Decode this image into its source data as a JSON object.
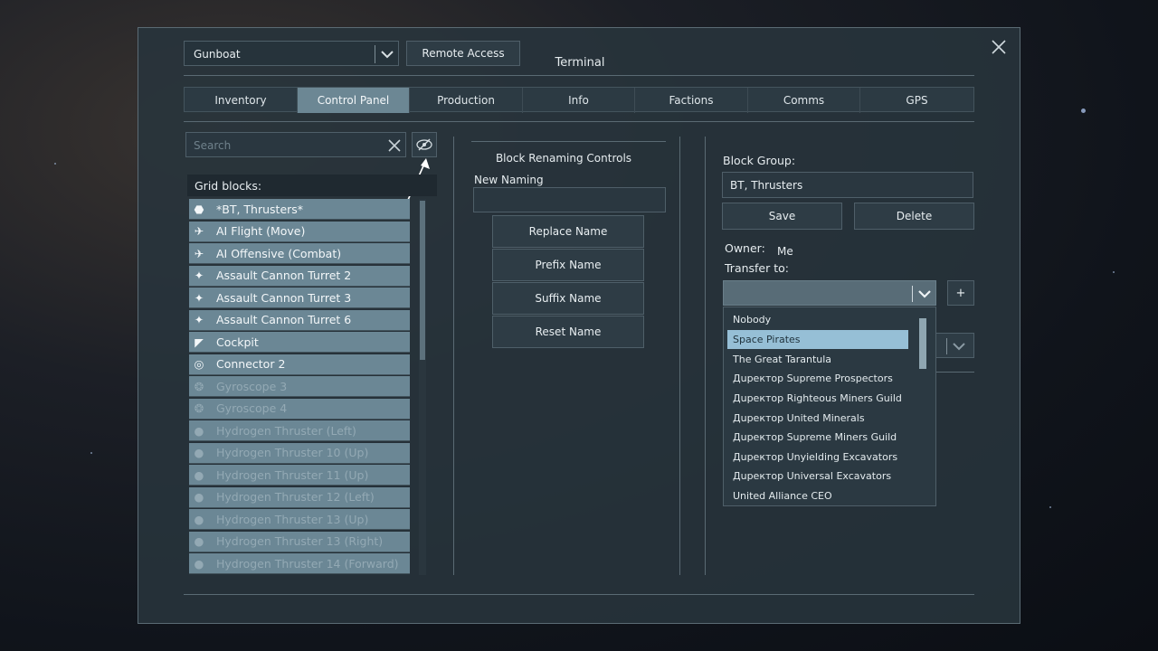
{
  "header": {
    "grid_select": "Gunboat",
    "remote_access_label": "Remote Access",
    "title": "Terminal"
  },
  "tabs": [
    {
      "label": "Inventory"
    },
    {
      "label": "Control Panel"
    },
    {
      "label": "Production"
    },
    {
      "label": "Info"
    },
    {
      "label": "Factions"
    },
    {
      "label": "Comms"
    },
    {
      "label": "GPS"
    }
  ],
  "left": {
    "search_placeholder": "Search",
    "grid_blocks_label": "Grid blocks:",
    "items": [
      {
        "label": "*BT, Thrusters*",
        "icon": "group-icon"
      },
      {
        "label": "AI Flight (Move)",
        "icon": "ai-flight-icon"
      },
      {
        "label": "AI Offensive (Combat)",
        "icon": "ai-offensive-icon"
      },
      {
        "label": "Assault Cannon Turret 2",
        "icon": "turret-icon"
      },
      {
        "label": "Assault Cannon Turret 3",
        "icon": "turret-icon"
      },
      {
        "label": "Assault Cannon Turret 6",
        "icon": "turret-icon"
      },
      {
        "label": "Cockpit",
        "icon": "cockpit-icon"
      },
      {
        "label": "Connector 2",
        "icon": "connector-icon"
      },
      {
        "label": "Gyroscope 3",
        "icon": "gyroscope-icon"
      },
      {
        "label": "Gyroscope 4",
        "icon": "gyroscope-icon"
      },
      {
        "label": "Hydrogen Thruster (Left)",
        "icon": "thruster-icon"
      },
      {
        "label": "Hydrogen Thruster 10 (Up)",
        "icon": "thruster-icon"
      },
      {
        "label": "Hydrogen Thruster 11 (Up)",
        "icon": "thruster-icon"
      },
      {
        "label": "Hydrogen Thruster 12 (Left)",
        "icon": "thruster-icon"
      },
      {
        "label": "Hydrogen Thruster 13 (Up)",
        "icon": "thruster-icon"
      },
      {
        "label": "Hydrogen Thruster 13 (Right)",
        "icon": "thruster-icon"
      },
      {
        "label": "Hydrogen Thruster 14 (Forward)",
        "icon": "thruster-icon"
      }
    ]
  },
  "middle": {
    "title": "Block Renaming Controls",
    "new_naming_label": "New Naming",
    "new_naming_value": "",
    "replace_label": "Replace Name",
    "prefix_label": "Prefix Name",
    "suffix_label": "Suffix Name",
    "reset_label": "Reset Name"
  },
  "right": {
    "block_group_label": "Block Group:",
    "block_group_value": "BT, Thrusters",
    "save_label": "Save",
    "delete_label": "Delete",
    "owner_label": "Owner:",
    "owner_value": "Me",
    "transfer_label": "Transfer to:",
    "transfer_value": "",
    "add_label": "+",
    "owners": [
      {
        "label": "Nobody"
      },
      {
        "label": "Space Pirates"
      },
      {
        "label": "The Great Tarantula"
      },
      {
        "label": "Дupeктop Supreme Prospectors"
      },
      {
        "label": "Дupeктop Righteous Miners Guild"
      },
      {
        "label": "Дupeктop United Minerals"
      },
      {
        "label": "Дupeктop Supreme Miners Guild"
      },
      {
        "label": "Дupeктop Unyielding Excavators"
      },
      {
        "label": "Дupeктop Universal Excavators"
      },
      {
        "label": "United Alliance CEO"
      }
    ]
  },
  "colors": {
    "accent": "#6b8795",
    "selected_owner": "#96bfd6",
    "active_tab": "#6c8794"
  }
}
